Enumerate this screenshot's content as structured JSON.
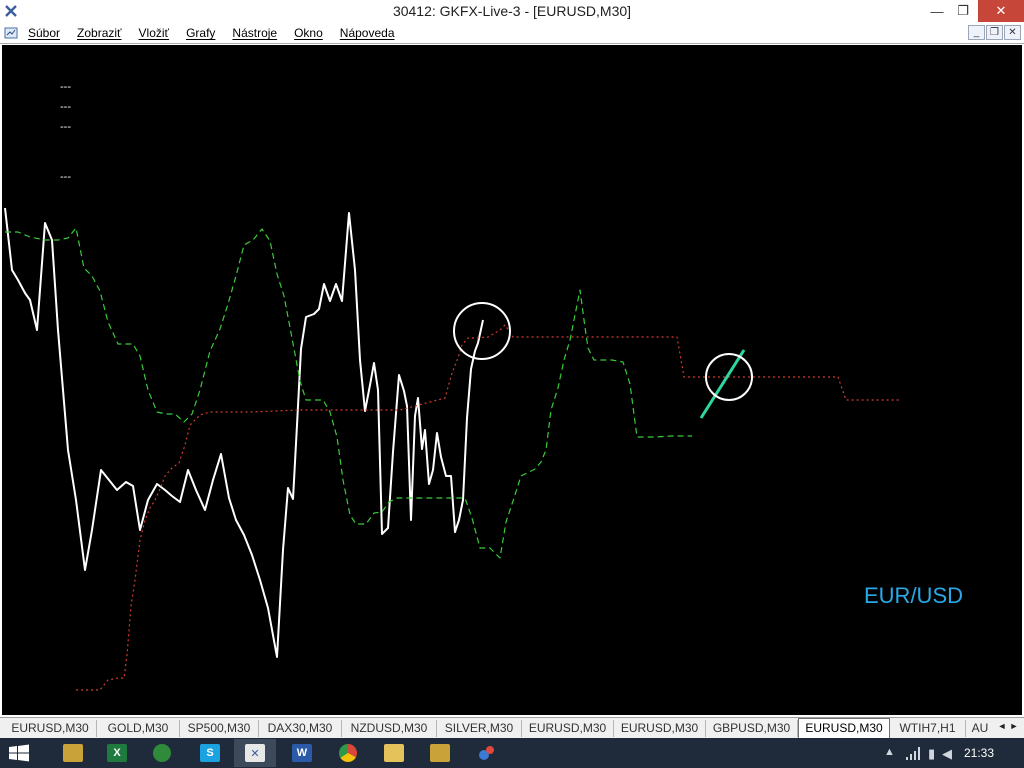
{
  "window": {
    "title": "30412: GKFX-Live-3 - [EURUSD,M30]",
    "min_glyph": "—",
    "max_glyph": "❐",
    "close_glyph": "✕"
  },
  "menu": {
    "items": [
      "Súbor",
      "Zobraziť",
      "Vložiť",
      "Grafy",
      "Nástroje",
      "Okno",
      "Nápoveda"
    ],
    "mdi_min": "_",
    "mdi_restore": "❐",
    "mdi_close": "✕"
  },
  "chart": {
    "symbol": "EUR/USD",
    "background": "#000000",
    "price_color": "#ffffff",
    "green_line_color": "#3aca3a",
    "red_line_color": "#d23c2c",
    "highlight_color": "#2ed6a0",
    "marker_color": "#ffffff",
    "level_labels": [
      "---",
      "---",
      "---",
      "---"
    ]
  },
  "chart_data": {
    "type": "line",
    "series": [
      {
        "style": "solid",
        "color": "#ffffff",
        "points": [
          [
            5,
            208
          ],
          [
            12,
            270
          ],
          [
            18,
            280
          ],
          [
            25,
            293
          ],
          [
            30,
            300
          ],
          [
            37,
            330
          ],
          [
            45,
            223
          ],
          [
            52,
            240
          ],
          [
            58,
            330
          ],
          [
            68,
            450
          ],
          [
            76,
            500
          ],
          [
            85,
            570
          ],
          [
            92,
            530
          ],
          [
            101,
            470
          ],
          [
            109,
            480
          ],
          [
            117,
            490
          ],
          [
            126,
            482
          ],
          [
            133,
            486
          ],
          [
            140,
            530
          ],
          [
            148,
            500
          ],
          [
            157,
            484
          ],
          [
            165,
            490
          ],
          [
            172,
            496
          ],
          [
            180,
            502
          ],
          [
            188,
            470
          ],
          [
            196,
            490
          ],
          [
            205,
            510
          ],
          [
            213,
            480
          ],
          [
            221,
            454
          ],
          [
            229,
            498
          ],
          [
            236,
            520
          ],
          [
            244,
            535
          ],
          [
            252,
            555
          ],
          [
            260,
            580
          ],
          [
            268,
            608
          ],
          [
            277,
            657
          ],
          [
            283,
            550
          ],
          [
            288,
            488
          ],
          [
            293,
            499
          ],
          [
            297,
            425
          ],
          [
            301,
            349
          ],
          [
            306,
            317
          ],
          [
            314,
            314
          ],
          [
            319,
            309
          ],
          [
            324,
            284
          ],
          [
            330,
            301
          ],
          [
            336,
            284
          ],
          [
            342,
            301
          ],
          [
            349,
            213
          ],
          [
            355,
            270
          ],
          [
            360,
            360
          ],
          [
            365,
            411
          ],
          [
            370,
            385
          ],
          [
            374,
            363
          ],
          [
            378,
            390
          ],
          [
            382,
            534
          ],
          [
            388,
            528
          ],
          [
            393,
            452
          ],
          [
            399,
            375
          ],
          [
            404,
            391
          ],
          [
            407,
            406
          ],
          [
            411,
            520
          ],
          [
            415,
            416
          ],
          [
            418,
            398
          ],
          [
            422,
            449
          ],
          [
            425,
            430
          ],
          [
            429,
            484
          ],
          [
            433,
            470
          ],
          [
            437,
            433
          ],
          [
            441,
            457
          ],
          [
            446,
            476
          ],
          [
            451,
            476
          ],
          [
            455,
            532
          ],
          [
            459,
            520
          ],
          [
            463,
            500
          ],
          [
            467,
            418
          ],
          [
            471,
            369
          ],
          [
            475,
            351
          ],
          [
            478,
            343
          ],
          [
            483,
            320
          ]
        ]
      },
      {
        "style": "dashed",
        "color": "#3aca3a",
        "points": [
          [
            5,
            232
          ],
          [
            18,
            232
          ],
          [
            30,
            237
          ],
          [
            45,
            240
          ],
          [
            58,
            240
          ],
          [
            68,
            238
          ],
          [
            76,
            228
          ],
          [
            84,
            268
          ],
          [
            92,
            276
          ],
          [
            100,
            291
          ],
          [
            108,
            322
          ],
          [
            118,
            344
          ],
          [
            133,
            344
          ],
          [
            140,
            356
          ],
          [
            148,
            390
          ],
          [
            157,
            412
          ],
          [
            166,
            414
          ],
          [
            175,
            414
          ],
          [
            184,
            422
          ],
          [
            192,
            414
          ],
          [
            200,
            390
          ],
          [
            210,
            351
          ],
          [
            220,
            329
          ],
          [
            228,
            304
          ],
          [
            236,
            276
          ],
          [
            244,
            245
          ],
          [
            253,
            240
          ],
          [
            262,
            229
          ],
          [
            270,
            241
          ],
          [
            277,
            274
          ],
          [
            284,
            296
          ],
          [
            292,
            338
          ],
          [
            300,
            381
          ],
          [
            306,
            400
          ],
          [
            315,
            400
          ],
          [
            323,
            400
          ],
          [
            330,
            412
          ],
          [
            337,
            437
          ],
          [
            343,
            480
          ],
          [
            350,
            515
          ],
          [
            356,
            524
          ],
          [
            366,
            524
          ],
          [
            374,
            513
          ],
          [
            382,
            512
          ],
          [
            389,
            502
          ],
          [
            397,
            498
          ],
          [
            407,
            498
          ],
          [
            420,
            498
          ],
          [
            433,
            498
          ],
          [
            450,
            498
          ],
          [
            458,
            498
          ],
          [
            465,
            498
          ],
          [
            472,
            518
          ],
          [
            480,
            548
          ],
          [
            490,
            548
          ],
          [
            500,
            558
          ],
          [
            506,
            522
          ],
          [
            514,
            498
          ],
          [
            521,
            476
          ],
          [
            535,
            469
          ],
          [
            541,
            462
          ],
          [
            546,
            450
          ],
          [
            551,
            410
          ],
          [
            558,
            388
          ],
          [
            564,
            360
          ],
          [
            570,
            340
          ],
          [
            576,
            310
          ],
          [
            580,
            290
          ],
          [
            584,
            320
          ],
          [
            588,
            348
          ],
          [
            594,
            360
          ],
          [
            612,
            360
          ],
          [
            623,
            362
          ],
          [
            630,
            384
          ],
          [
            637,
            437
          ],
          [
            655,
            437
          ],
          [
            672,
            436
          ],
          [
            692,
            436
          ]
        ]
      },
      {
        "style": "dotted",
        "color": "#d23c2c",
        "points": [
          [
            76,
            690
          ],
          [
            100,
            690
          ],
          [
            108,
            680
          ],
          [
            118,
            678
          ],
          [
            124,
            678
          ],
          [
            127,
            655
          ],
          [
            131,
            606
          ],
          [
            135,
            580
          ],
          [
            140,
            540
          ],
          [
            145,
            520
          ],
          [
            150,
            508
          ],
          [
            155,
            500
          ],
          [
            160,
            489
          ],
          [
            165,
            476
          ],
          [
            172,
            468
          ],
          [
            179,
            463
          ],
          [
            185,
            445
          ],
          [
            190,
            425
          ],
          [
            200,
            415
          ],
          [
            210,
            412
          ],
          [
            220,
            412
          ],
          [
            250,
            412
          ],
          [
            300,
            410
          ],
          [
            360,
            410
          ],
          [
            400,
            410
          ],
          [
            430,
            402
          ],
          [
            445,
            398
          ],
          [
            452,
            373
          ],
          [
            458,
            358
          ],
          [
            462,
            345
          ],
          [
            468,
            338
          ],
          [
            476,
            338
          ],
          [
            488,
            337
          ],
          [
            500,
            330
          ],
          [
            505,
            325
          ],
          [
            513,
            337
          ],
          [
            540,
            337
          ],
          [
            600,
            337
          ],
          [
            660,
            337
          ],
          [
            677,
            337
          ],
          [
            684,
            377
          ],
          [
            700,
            377
          ],
          [
            770,
            377
          ],
          [
            838,
            377
          ],
          [
            846,
            400
          ],
          [
            870,
            400
          ],
          [
            900,
            400
          ]
        ]
      },
      {
        "style": "solid",
        "color": "#2ed6a0",
        "points": [
          [
            701,
            418
          ],
          [
            744,
            350
          ]
        ]
      }
    ],
    "markers": [
      {
        "type": "circle",
        "cx": 482,
        "cy": 331,
        "r": 28
      },
      {
        "type": "circle",
        "cx": 729,
        "cy": 377,
        "r": 23
      }
    ]
  },
  "tabs": {
    "items": [
      "EURUSD,M30",
      "GOLD,M30",
      "SP500,M30",
      "DAX30,M30",
      "NZDUSD,M30",
      "SILVER,M30",
      "EURUSD,M30",
      "EURUSD,M30",
      "GBPUSD,M30",
      "EURUSD,M30",
      "WTIH7,H1",
      "AU"
    ],
    "active_index": 9,
    "left_arrow": "◄",
    "right_arrow": "►"
  },
  "taskbar": {
    "clock": "21:33",
    "apps": [
      "excel-icon",
      "mt-green-icon",
      "skype-icon",
      "metatrader-icon",
      "word-icon",
      "chrome-icon",
      "explorer-icon",
      "app-icon",
      "dots-icon"
    ]
  }
}
